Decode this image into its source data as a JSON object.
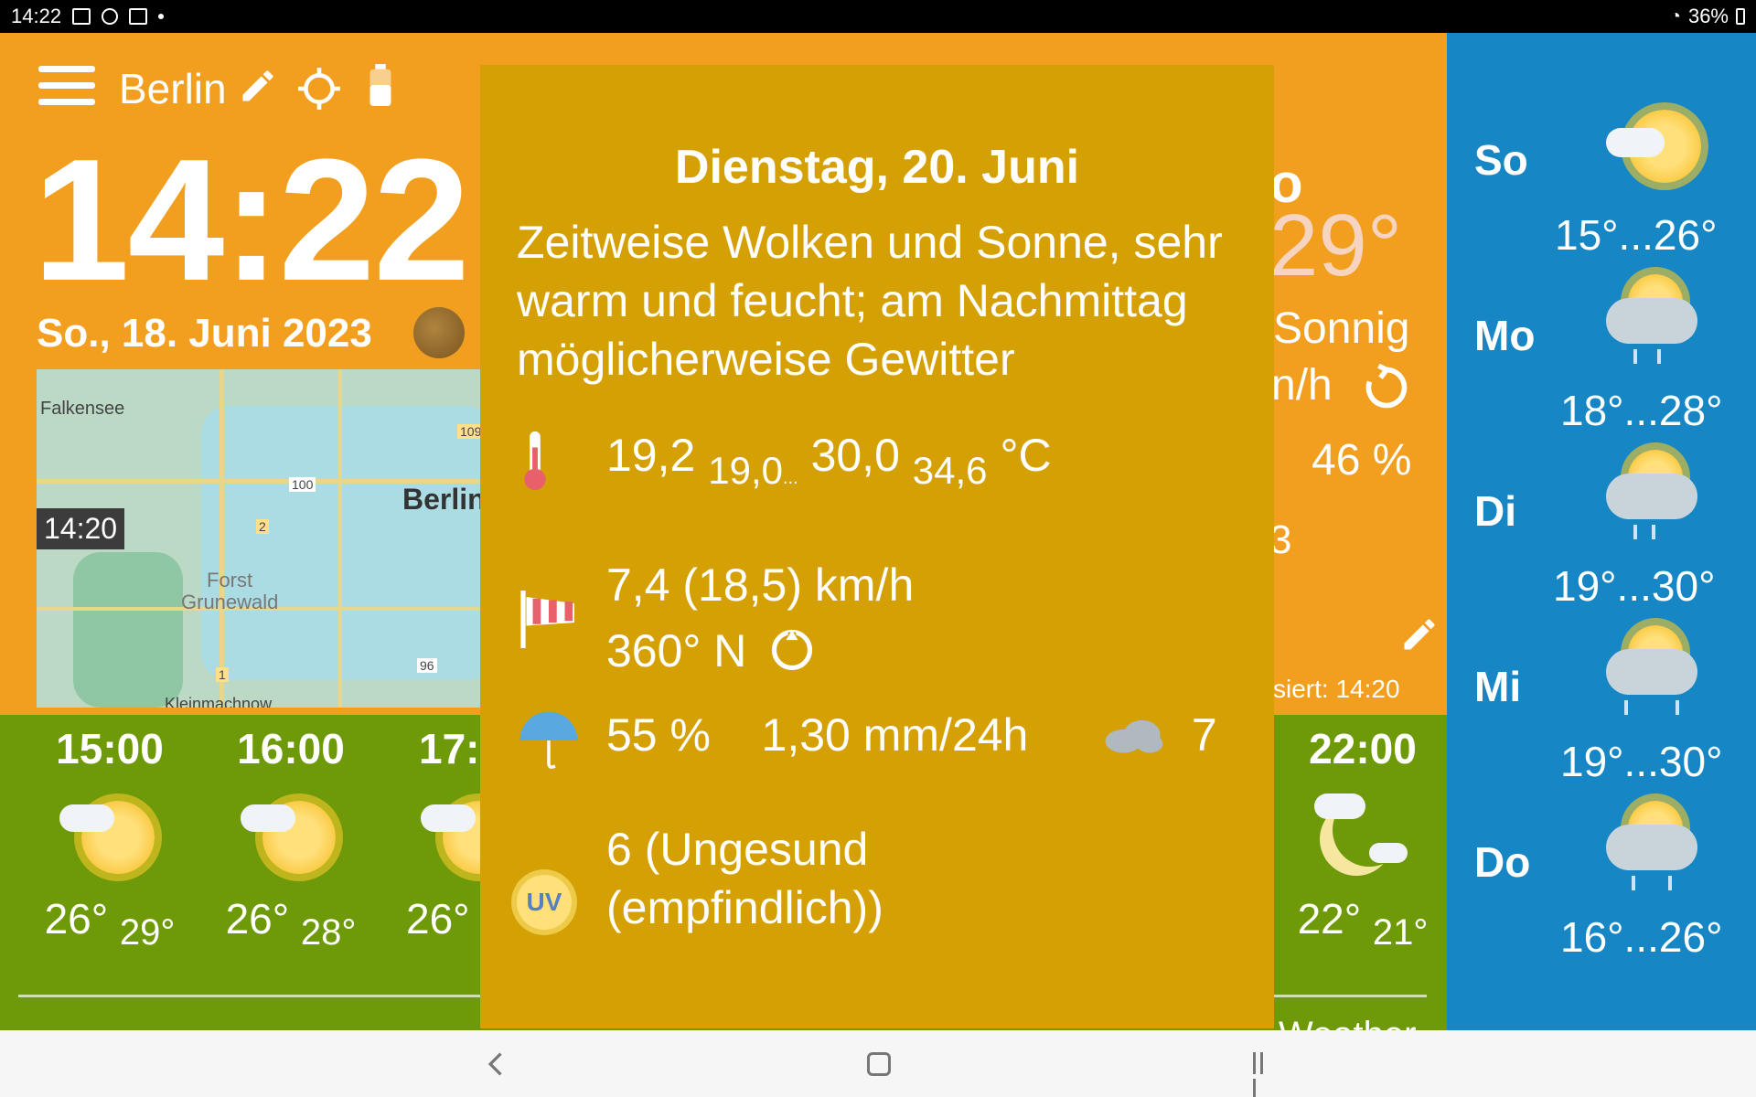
{
  "statusbar": {
    "time": "14:22",
    "battery": "36%"
  },
  "header": {
    "city": "Berlin"
  },
  "clock": {
    "time": "14:22",
    "date": "So., 18. Juni 2023"
  },
  "map": {
    "labels": [
      "Falkensee",
      "Berlin",
      "Forst",
      "Grunewald",
      "100",
      "109",
      "2",
      "1",
      "96",
      "Kleinmachnow"
    ],
    "timestamp": "14:20"
  },
  "current": {
    "temp_fragment": "29°",
    "condition_fragment": "Sonnig",
    "wind_fragment": "n/h",
    "humidity": "46 %",
    "fragment_3": "3",
    "fragment_d": "o",
    "updated": "siert: 14:20"
  },
  "hourly": [
    {
      "time": "15:00",
      "temp": "26°",
      "feels": "29°"
    },
    {
      "time": "16:00",
      "temp": "26°",
      "feels": "28°"
    },
    {
      "time": "17:",
      "temp": "26°",
      "feels": ""
    },
    {
      "time": "22:00",
      "temp": "22°",
      "feels": "21°"
    }
  ],
  "brand": "Weather",
  "forecast": [
    {
      "day": "So",
      "range": "15°...26°",
      "icon": "sun-cloud-icon"
    },
    {
      "day": "Mo",
      "range": "18°...28°",
      "icon": "rain-cloud-icon"
    },
    {
      "day": "Di",
      "range": "19°...30°",
      "icon": "rain-cloud-icon"
    },
    {
      "day": "Mi",
      "range": "19°...30°",
      "icon": "rain-cloud-icon"
    },
    {
      "day": "Do",
      "range": "16°...26°",
      "icon": "rain-cloud-icon"
    }
  ],
  "popup": {
    "title": "Dienstag, 20. Juni",
    "description": "Zeitweise Wolken und Sonne, sehr warm und feucht; am Nachmittag möglicherweise Gewitter",
    "temp_now": "19,2",
    "temp_min": "19,0",
    "temp_dots": "...",
    "temp_max": "30,0",
    "temp_feels": "34,6",
    "temp_unit": "°C",
    "wind": "7,4 (18,5) km/h",
    "wind_dir": "360° N",
    "precip_prob": "55 %",
    "precip_amount": "1,30 mm/24h",
    "cloud_value": "7",
    "uv": "6 (Ungesund (empfindlich))",
    "uv_badge": "UV"
  },
  "colors": {
    "orange": "#f29e1e",
    "green": "#6e9a0a",
    "blue": "#1786c4",
    "popup": "#d4a004"
  }
}
